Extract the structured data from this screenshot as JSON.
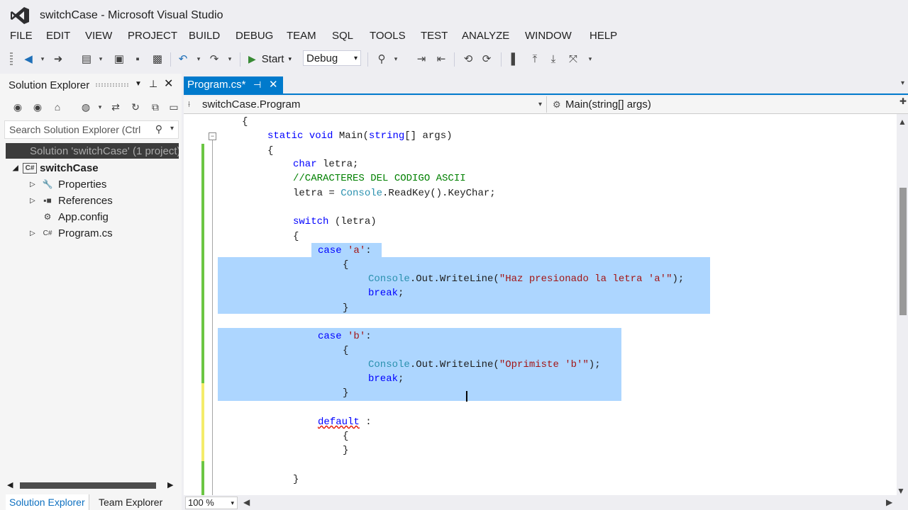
{
  "window": {
    "title": "switchCase - Microsoft Visual Studio"
  },
  "menu": [
    "FILE",
    "EDIT",
    "VIEW",
    "PROJECT",
    "BUILD",
    "DEBUG",
    "TEAM",
    "SQL",
    "TOOLS",
    "TEST",
    "ANALYZE",
    "WINDOW",
    "HELP"
  ],
  "toolbar": {
    "start_label": "Start",
    "config_value": "Debug"
  },
  "solution_explorer": {
    "title": "Solution Explorer",
    "search_placeholder": "Search Solution Explorer (Ctrl",
    "solution_label": "Solution 'switchCase' (1 project)",
    "project_label": "switchCase",
    "items": [
      {
        "label": "Properties",
        "icon": "wrench-icon"
      },
      {
        "label": "References",
        "icon": "references-icon"
      },
      {
        "label": "App.config",
        "icon": "config-file-icon"
      },
      {
        "label": "Program.cs",
        "icon": "csharp-file-icon"
      }
    ],
    "tabs": [
      "Solution Explorer",
      "Team Explorer"
    ]
  },
  "editor": {
    "tab_label": "Program.cs*",
    "nav_type": "switchCase.Program",
    "nav_member": "Main(string[] args)",
    "zoom": "100 %"
  },
  "code": {
    "l0": "{",
    "l1_kw1": "static",
    "l1_kw2": "void",
    "l1_name": "Main(",
    "l1_kw3": "string",
    "l1_rest": "[] args)",
    "l2": "{",
    "l3_kw": "char",
    "l3_rest": " letra;",
    "l4": "//CARACTERES DEL CODIGO ASCII",
    "l5_a": "letra = ",
    "l5_ty": "Console",
    "l5_b": ".ReadKey().KeyChar;",
    "l7_kw": "switch",
    "l7_rest": " (letra)",
    "l8": "{",
    "l9_kw": "case",
    "l9_st": "'a'",
    "l9_rest": ":",
    "l10": "{",
    "l11_ty": "Console",
    "l11_a": ".Out.WriteLine(",
    "l11_st": "\"Haz presionado la letra 'a'\"",
    "l11_b": ");",
    "l12_kw": "break",
    "l12_rest": ";",
    "l13": "}",
    "l15_kw": "case",
    "l15_st": "'b'",
    "l15_rest": ":",
    "l16": "{",
    "l17_ty": "Console",
    "l17_a": ".Out.WriteLine(",
    "l17_st": "\"Oprimiste 'b'\"",
    "l17_b": ");",
    "l18_kw": "break",
    "l18_rest": ";",
    "l19": "}",
    "l21_kw": "default",
    "l21_rest": " :",
    "l22": "{",
    "l23": "}",
    "l25": "}"
  },
  "colors": {
    "accent": "#007acc",
    "selection": "#add6ff",
    "keyword": "#0000ff",
    "comment": "#008000",
    "type": "#2b91af",
    "string": "#a31515"
  }
}
